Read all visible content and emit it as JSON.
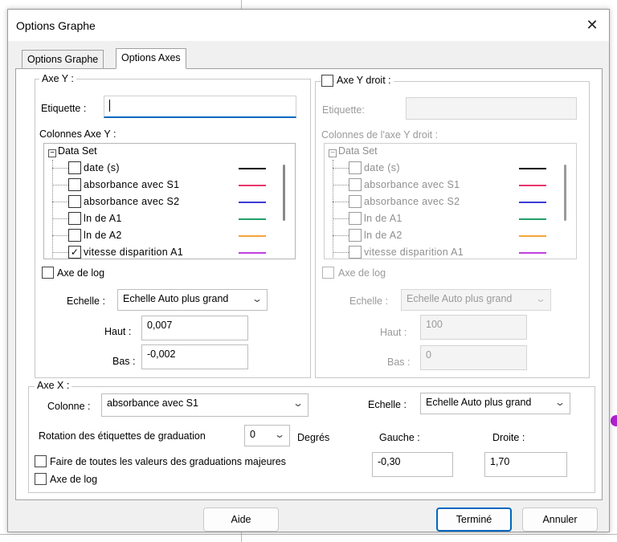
{
  "window": {
    "title": "Options Graphe",
    "close_icon": "close-icon"
  },
  "tabs": [
    {
      "label": "Options Graphe",
      "active": false
    },
    {
      "label": "Options Axes",
      "active": true
    }
  ],
  "y_axis": {
    "group_label": "Axe Y :",
    "label_caption": "Etiquette :",
    "label_value": "",
    "columns_caption": "Colonnes Axe Y :",
    "tree_root": "Data Set",
    "columns": [
      {
        "name": "date (s)",
        "checked": false,
        "color": "#000000"
      },
      {
        "name": "absorbance avec S1",
        "checked": false,
        "color": "#e8336b"
      },
      {
        "name": "absorbance avec S2",
        "checked": false,
        "color": "#3b3bd6"
      },
      {
        "name": "ln de A1",
        "checked": false,
        "color": "#22a06b"
      },
      {
        "name": "ln de A2",
        "checked": false,
        "color": "#f5a53a"
      },
      {
        "name": "vitesse disparition A1",
        "checked": true,
        "color": "#c040e0"
      }
    ],
    "log_caption": "Axe de log",
    "log_checked": false,
    "scale_caption": "Echelle :",
    "scale_value": "Echelle Auto plus grand",
    "high_caption": "Haut :",
    "high_value": "0,007",
    "low_caption": "Bas :",
    "low_value": "-0,002"
  },
  "y_axis_right": {
    "group_label": "Axe Y droit :",
    "enabled": false,
    "label_caption": "Etiquette:",
    "label_value": "",
    "columns_caption": "Colonnes de l'axe Y droit :",
    "tree_root": "Data Set",
    "columns": [
      {
        "name": "date (s)",
        "checked": false,
        "color": "#000000"
      },
      {
        "name": "absorbance avec S1",
        "checked": false,
        "color": "#e8336b"
      },
      {
        "name": "absorbance avec S2",
        "checked": false,
        "color": "#3b3bd6"
      },
      {
        "name": "ln de A1",
        "checked": false,
        "color": "#22a06b"
      },
      {
        "name": "ln de A2",
        "checked": false,
        "color": "#f5a53a"
      },
      {
        "name": "vitesse disparition A1",
        "checked": false,
        "color": "#c040e0"
      }
    ],
    "log_caption": "Axe de log",
    "scale_caption": "Echelle :",
    "scale_value": "Echelle Auto plus grand",
    "high_caption": "Haut :",
    "high_value": "100",
    "low_caption": "Bas :",
    "low_value": "0"
  },
  "x_axis": {
    "group_label": "Axe X :",
    "column_caption": "Colonne :",
    "column_value": "absorbance avec S1",
    "scale_caption": "Echelle :",
    "scale_value": "Echelle Auto plus grand",
    "rotation_caption": "Rotation des étiquettes de graduation",
    "rotation_value": "0",
    "degrees_caption": "Degrés",
    "left_caption": "Gauche :",
    "left_value": "-0,30",
    "right_caption": "Droite :",
    "right_value": "1,70",
    "major_caption": "Faire de toutes les valeurs des graduations majeures",
    "log_caption": "Axe de log"
  },
  "buttons": {
    "help": "Aide",
    "done": "Terminé",
    "cancel": "Annuler"
  }
}
